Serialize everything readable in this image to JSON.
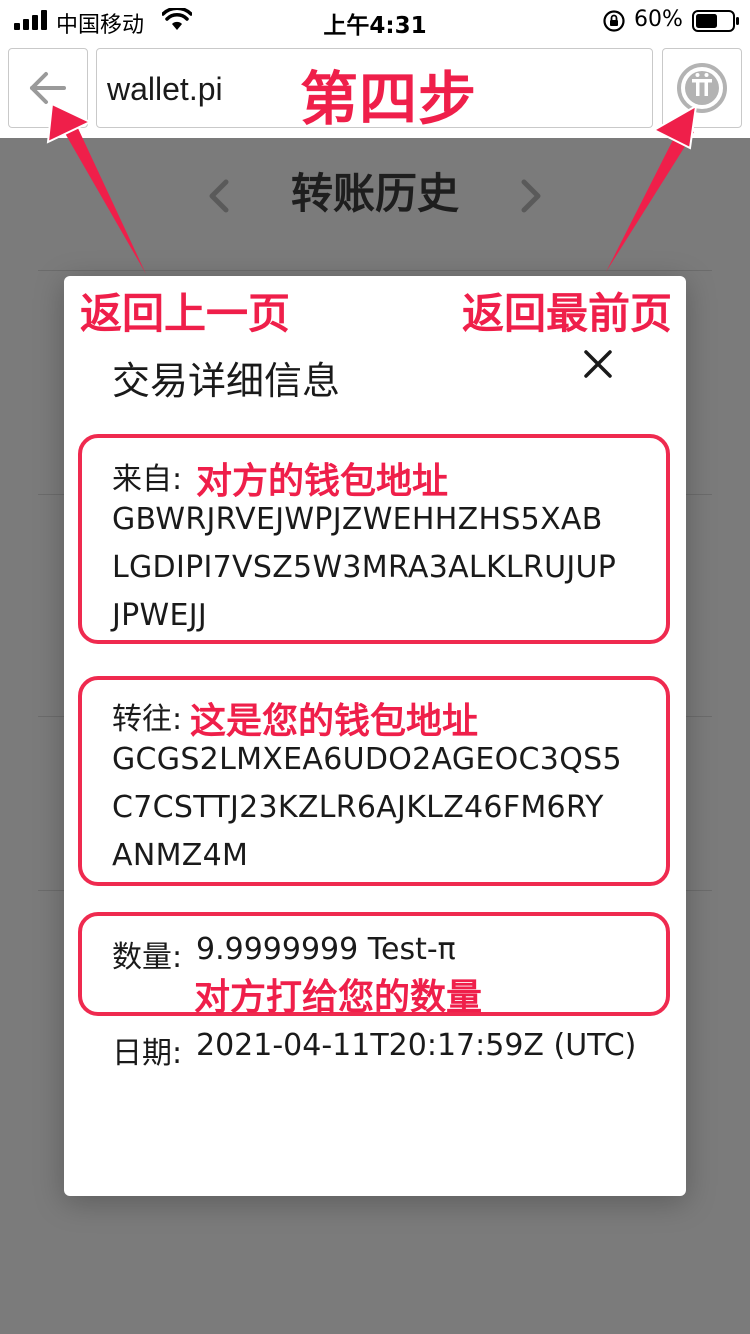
{
  "status_bar": {
    "carrier": "中国移动",
    "time": "上午4:31",
    "battery_percent": "60%",
    "battery_level": 0.6
  },
  "browser": {
    "url": "wallet.pi"
  },
  "annotations": {
    "step": "第四步",
    "back_hint": "返回上一页",
    "home_hint": "返回最前页",
    "from_hint": "对方的钱包地址",
    "to_hint": "这是您的钱包地址",
    "amount_hint": "对方打给您的数量",
    "accent_color": "#ef1f4a"
  },
  "background_page": {
    "title": "转账历史"
  },
  "modal": {
    "title": "交易详细信息",
    "from_label": "来自:",
    "from_address_lines": [
      "GBWRJRVEJWPJZWEHHZHS5XAB",
      "LGDIPI7VSZ5W3MRA3ALKLRUJUP",
      "JPWEJJ"
    ],
    "to_label": "转往:",
    "to_address_lines": [
      "GCGS2LMXEA6UDO2AGEOC3QS5",
      "C7CSTTJ23KZLR6AJKLZ46FM6RY",
      "ANMZ4M"
    ],
    "amount_label": "数量:",
    "amount_value": "9.9999999 Test-π",
    "date_label": "日期:",
    "date_value": "2021-04-11T20:17:59Z (UTC)"
  }
}
